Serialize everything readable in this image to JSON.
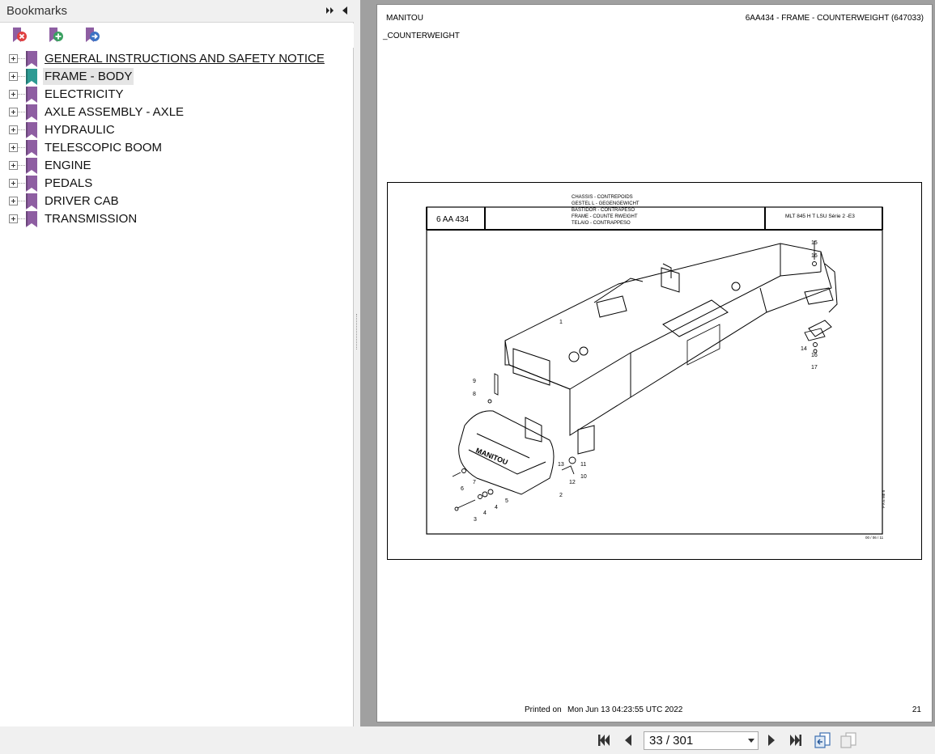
{
  "panel": {
    "title": "Bookmarks",
    "bookmarks": [
      {
        "label": "GENERAL INSTRUCTIONS AND SAFETY NOTICE",
        "color": "#8e5ea2"
      },
      {
        "label": "FRAME - BODY",
        "color": "#2e9a93"
      },
      {
        "label": "ELECTRICITY",
        "color": "#8e5ea2"
      },
      {
        "label": "AXLE ASSEMBLY - AXLE",
        "color": "#8e5ea2"
      },
      {
        "label": "HYDRAULIC",
        "color": "#8e5ea2"
      },
      {
        "label": "TELESCOPIC BOOM",
        "color": "#8e5ea2"
      },
      {
        "label": "ENGINE",
        "color": "#8e5ea2"
      },
      {
        "label": "PEDALS",
        "color": "#8e5ea2"
      },
      {
        "label": "DRIVER CAB",
        "color": "#8e5ea2"
      },
      {
        "label": "TRANSMISSION",
        "color": "#8e5ea2"
      }
    ]
  },
  "document": {
    "header_left": "MANITOU",
    "header_right": "6AA434 - FRAME - COUNTERWEIGHT (647033)",
    "subtitle": "_COUNTERWEIGHT",
    "drawing": {
      "code": "6 AA 434",
      "titles": [
        "CHASSIS - CONTREPOIDS",
        "GESTEL   L - GEGENGEWICHT",
        "BASTIDOR - CONTRAPESO",
        "FRAME - COUNTE      RWEIGHT",
        "TELAIO - CONTRAPPESO"
      ],
      "model": "MLT 845 H T LSU Série 2 -E3",
      "stamp": "00 / 06 / 11",
      "side_mark": "P A E    Mb h",
      "callouts": [
        "1",
        "2",
        "3",
        "4",
        "4",
        "5",
        "6",
        "7",
        "8",
        "9",
        "10",
        "11",
        "12",
        "13",
        "14",
        "15",
        "16",
        "16",
        "17"
      ],
      "logo_text": "MANITOU"
    },
    "footer_printed_label": "Printed on",
    "footer_printed_date": "Mon Jun 13 04:23:55 UTC 2022",
    "page_number": "21"
  },
  "nav": {
    "page_indicator": "33 / 301",
    "icons": [
      "first-page-icon",
      "previous-page-icon",
      "next-page-icon",
      "last-page-icon",
      "previous-view-icon",
      "next-view-icon"
    ]
  }
}
